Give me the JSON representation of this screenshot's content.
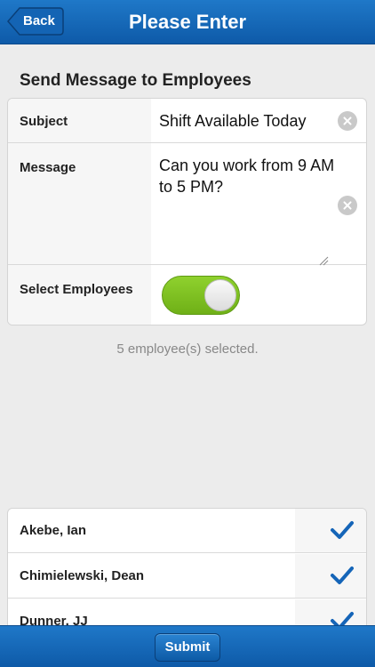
{
  "header": {
    "back_label": "Back",
    "title": "Please Enter"
  },
  "form": {
    "section_title": "Send Message to Employees",
    "subject": {
      "label": "Subject",
      "value": "Shift Available Today"
    },
    "message": {
      "label": "Message",
      "value": "Can you work from 9 AM to 5 PM?"
    },
    "select_employees": {
      "label": "Select Employees",
      "toggle_on": true
    }
  },
  "selection_summary": "5 employee(s) selected.",
  "employees": [
    {
      "name": "Akebe, Ian",
      "selected": true
    },
    {
      "name": "Chimielewski, Dean",
      "selected": true
    },
    {
      "name": "Dunner, JJ",
      "selected": true
    }
  ],
  "footer": {
    "submit_label": "Submit"
  },
  "colors": {
    "header_blue": "#1565b8",
    "toggle_green": "#7cc11f",
    "check_blue": "#1565b8"
  },
  "icons": {
    "back": "chevron-left",
    "clear": "clear-x-circle",
    "check": "checkmark",
    "resize": "resize-grip"
  }
}
